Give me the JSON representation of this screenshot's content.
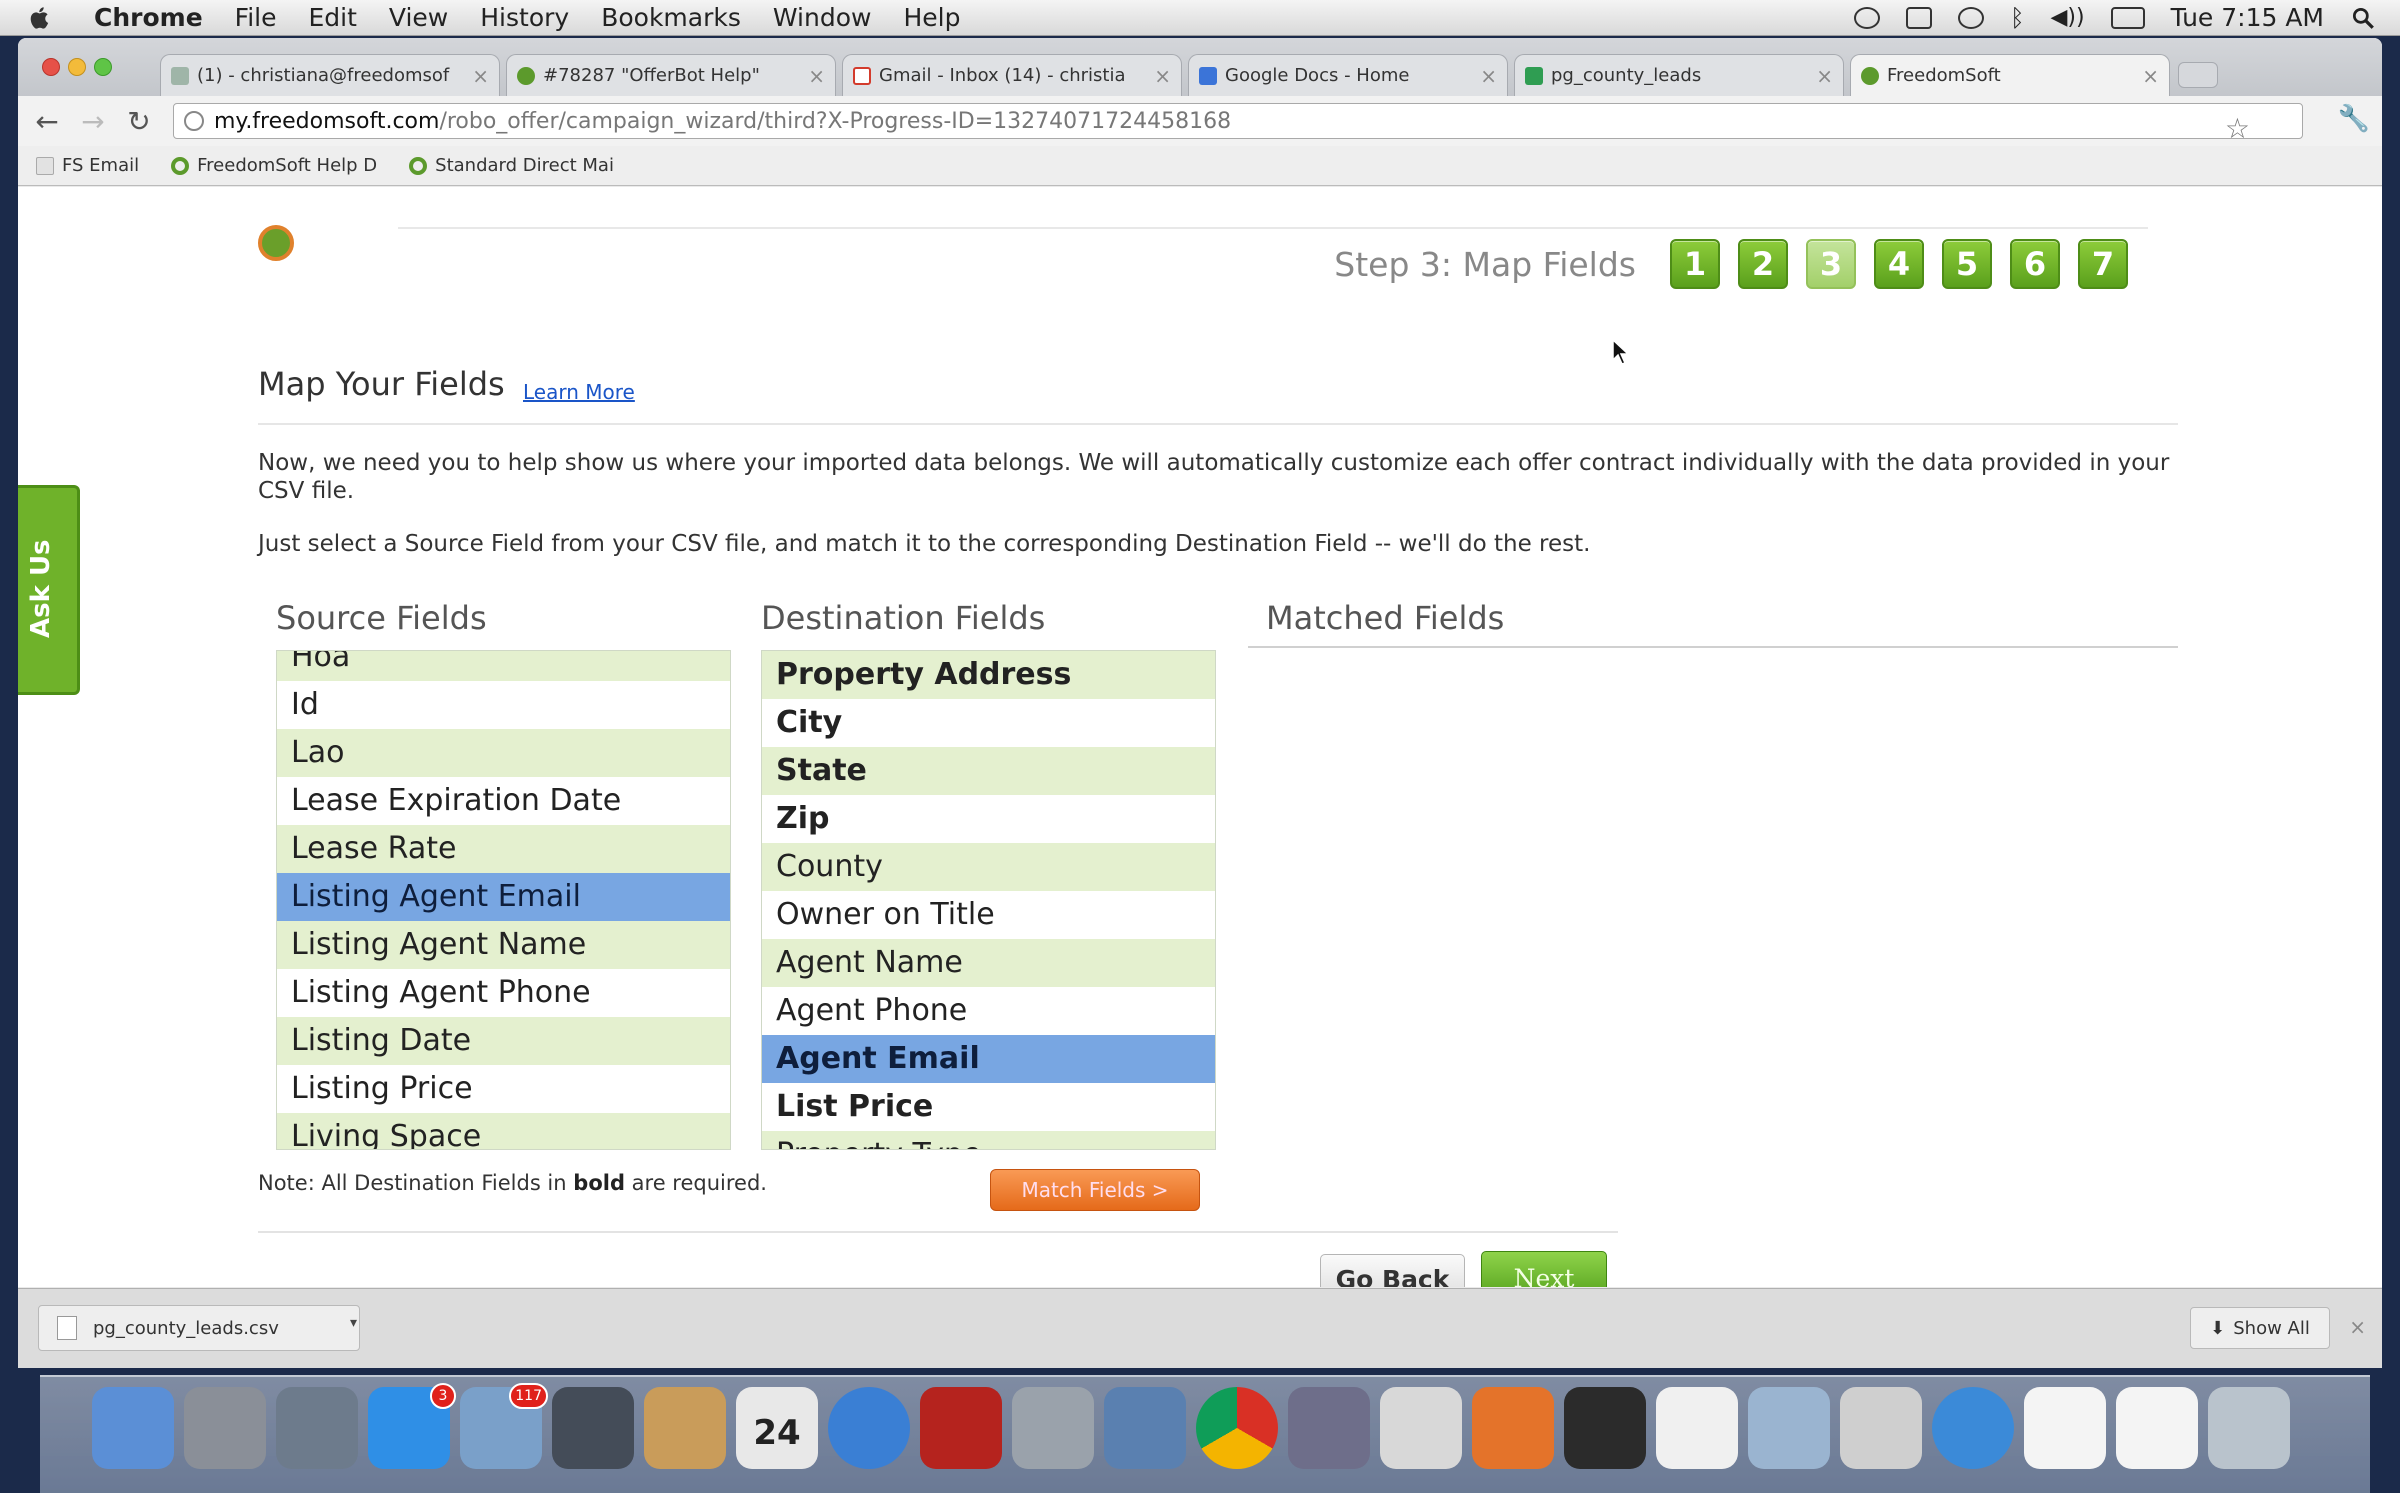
{
  "menubar": {
    "app": "Chrome",
    "items": [
      "File",
      "Edit",
      "View",
      "History",
      "Bookmarks",
      "Window",
      "Help"
    ],
    "clock": "Tue 7:15 AM"
  },
  "browser": {
    "tabs": [
      {
        "label": "(1) - christiana@freedomsof",
        "icon": "mail-icon",
        "color": "#9fb5a8"
      },
      {
        "label": "#78287 \"OfferBot Help\"",
        "icon": "freedomsoft-icon",
        "color": "#5c9a2c"
      },
      {
        "label": "Gmail - Inbox (14) - christia",
        "icon": "gmail-icon",
        "color": "#d33b2c"
      },
      {
        "label": "Google Docs - Home",
        "icon": "docs-icon",
        "color": "#3b74d8"
      },
      {
        "label": "pg_county_leads",
        "icon": "sheets-icon",
        "color": "#2f9d52"
      },
      {
        "label": "FreedomSoft",
        "icon": "freedomsoft-icon",
        "color": "#5c9a2c"
      }
    ],
    "url_host": "my.freedomsoft.com",
    "url_path": "/robo_offer/campaign_wizard/third?X-Progress-ID=13274071724458168",
    "bookmarks": [
      "FS Email",
      "FreedomSoft Help D",
      "Standard Direct Mai"
    ]
  },
  "wizard": {
    "step_label": "Step 3: Map Fields",
    "steps": [
      "1",
      "2",
      "3",
      "4",
      "5",
      "6",
      "7"
    ],
    "current_step": "3",
    "title": "Map Your Fields",
    "learn_more": "Learn More",
    "paragraph1": "Now, we need you to help show us where your imported data belongs. We will automatically customize each offer contract individually with the data provided in your CSV file.",
    "paragraph2": "Just select a Source Field from your CSV file, and match it to the corresponding Destination Field -- we'll do the rest.",
    "source_title": "Source Fields",
    "destination_title": "Destination Fields",
    "matched_title": "Matched Fields",
    "source_fields": [
      "Hoa",
      "Id",
      "Lao",
      "Lease Expiration Date",
      "Lease Rate",
      "Listing Agent Email",
      "Listing Agent Name",
      "Listing Agent Phone",
      "Listing Date",
      "Listing Price",
      "Living Space"
    ],
    "source_selected": "Listing Agent Email",
    "destination_fields": [
      {
        "label": "Property Address",
        "required": true
      },
      {
        "label": "City",
        "required": true
      },
      {
        "label": "State",
        "required": true
      },
      {
        "label": "Zip",
        "required": true
      },
      {
        "label": "County",
        "required": false
      },
      {
        "label": "Owner on Title",
        "required": false
      },
      {
        "label": "Agent Name",
        "required": false
      },
      {
        "label": "Agent Phone",
        "required": false
      },
      {
        "label": "Agent Email",
        "required": true
      },
      {
        "label": "List Price",
        "required": true
      },
      {
        "label": "Property Type",
        "required": false
      }
    ],
    "destination_selected": "Agent Email",
    "note_prefix": "Note: All Destination Fields in",
    "note_bold": "bold",
    "note_suffix": "are required.",
    "match_button": "Match Fields >",
    "go_back": "Go Back",
    "next": "Next"
  },
  "ask_us": "Ask Us",
  "downloads": {
    "file": "pg_county_leads.csv",
    "show_all": "Show All"
  },
  "dock": {
    "calendar_day": "24",
    "badges": {
      "app_store": "3",
      "mail": "117"
    },
    "icons": [
      "finder-icon",
      "launchpad-icon",
      "system-info-icon",
      "app-store-icon",
      "mail-icon",
      "facetime-icon",
      "contacts-icon",
      "calendar-icon",
      "itunes-icon",
      "photobooth-icon",
      "system-preferences-icon",
      "iphoto-icon",
      "chrome-icon",
      "imovie-icon",
      "preview-icon",
      "firefox-icon",
      "console-icon",
      "textedit-icon",
      "screenshot-icon",
      "calculator-icon",
      "safari-icon",
      "document-icon",
      "document-icon",
      "trash-icon"
    ]
  }
}
